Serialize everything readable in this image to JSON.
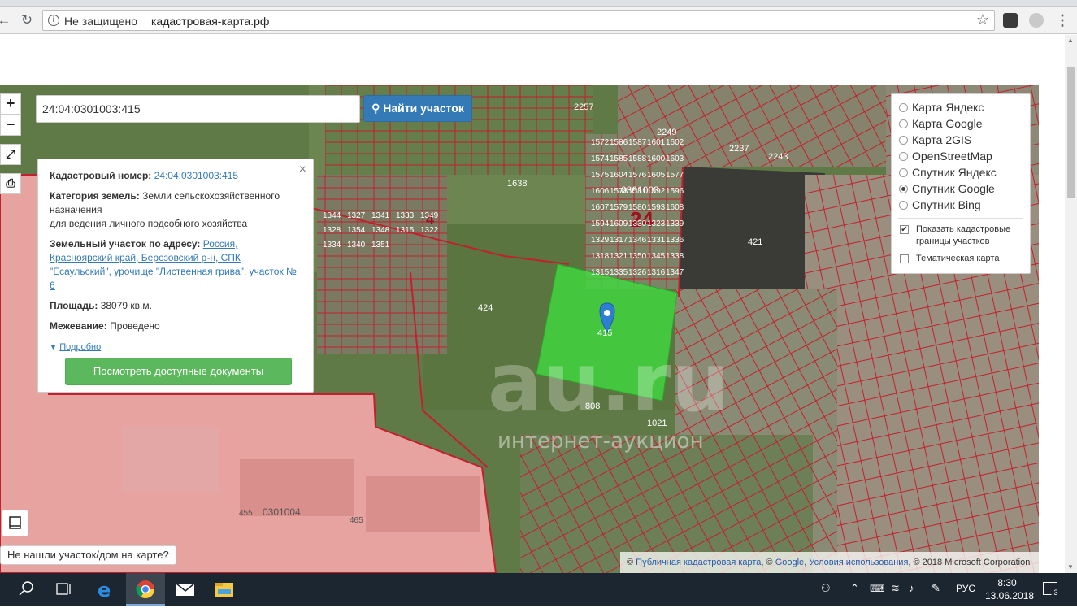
{
  "browser": {
    "security_label": "Не защищено",
    "url": "кадастровая-карта.рф"
  },
  "map": {
    "search_value": "24:04:0301003:415",
    "find_button": "Найти участок",
    "zoom_in": "+",
    "zoom_out": "−",
    "labels": {
      "quarter_main": "0301003",
      "quarter_number": "24",
      "quarter_number_left": "4",
      "quarter_bottom": "0301004",
      "parcel_selected": "415",
      "parcel_421": "421",
      "parcel_424": "424",
      "parcel_1638": "1638",
      "parcel_808": "808",
      "parcel_455": "455",
      "parcel_465": "465",
      "parcel_2257": "2257",
      "parcel_2243": "2243",
      "parcel_2249": "2249",
      "parcel_2237": "2237",
      "parcel_1021": "1021"
    },
    "small_parcels": [
      "1572",
      "1586",
      "1587",
      "1601",
      "1602",
      "1574",
      "1585",
      "1588",
      "1600",
      "1603",
      "1575",
      "1604",
      "1576",
      "1605",
      "1577",
      "1606",
      "1578",
      "1581",
      "1592",
      "1596",
      "1607",
      "1579",
      "1580",
      "1593",
      "1608",
      "1594",
      "1609",
      "1330",
      "1323",
      "1339",
      "1329",
      "1317",
      "1346",
      "1331",
      "1336",
      "1318",
      "1321",
      "1350",
      "1345",
      "1338",
      "1315",
      "1335",
      "1326",
      "1316",
      "1347",
      "1344",
      "1327",
      "1341",
      "1333",
      "1349",
      "1328",
      "1354",
      "1348",
      "1315",
      "1322",
      "1334",
      "1340",
      "1351"
    ],
    "watermark_big": "au.ru",
    "watermark_small": "интернет-аукцион"
  },
  "info": {
    "cadastral_label": "Кадастровый номер:",
    "cadastral_value": "24:04:0301003:415",
    "category_label": "Категория земель:",
    "category_value": "Земли сельскохозяйственного назначения",
    "usage_value": "для ведения личного подсобного хозяйства",
    "address_label": "Земельный участок по адресу:",
    "address_value": "Россия, Красноярский край, Березовский р-н, СПК \"Есаульский\", урочище \"Лиственная грива\", участок № 6",
    "area_label": "Площадь:",
    "area_value": "38079 кв.м.",
    "survey_label": "Межевание:",
    "survey_value": "Проведено",
    "more_link": "Подробно",
    "docs_button": "Посмотреть доступные документы",
    "close": "×"
  },
  "layers": {
    "options": [
      {
        "label": "Карта Яндекс",
        "selected": false
      },
      {
        "label": "Карта Google",
        "selected": false
      },
      {
        "label": "Карта 2GIS",
        "selected": false
      },
      {
        "label": "OpenStreetMap",
        "selected": false
      },
      {
        "label": "Спутник Яндекс",
        "selected": false
      },
      {
        "label": "Спутник Google",
        "selected": true
      },
      {
        "label": "Спутник Bing",
        "selected": false
      }
    ],
    "show_borders": "Показать кадастровые границы участков",
    "show_borders_checked": true,
    "thematic": "Тематическая карта",
    "thematic_checked": false
  },
  "bottom": {
    "not_found": "Не нашли участок/дом на карте?",
    "attribution_prefix": "© ",
    "attribution_link1": "Публичная кадастровая карта",
    "attribution_mid1": ", © ",
    "attribution_link2": "Google",
    "attribution_mid2": ", ",
    "attribution_link3": "Условия использования",
    "attribution_suffix": ", © 2018 Microsoft Corporation"
  },
  "taskbar": {
    "language": "РУС",
    "time": "8:30",
    "date": "13.06.2018",
    "notifications": "3"
  },
  "colors": {
    "parcel_border": "#c2202e",
    "selected_parcel": "#3fd93f",
    "pink_zone": "#e8a0a0",
    "link": "#337ab7",
    "find_button": "#337ab7",
    "docs_button": "#5cb85c"
  }
}
